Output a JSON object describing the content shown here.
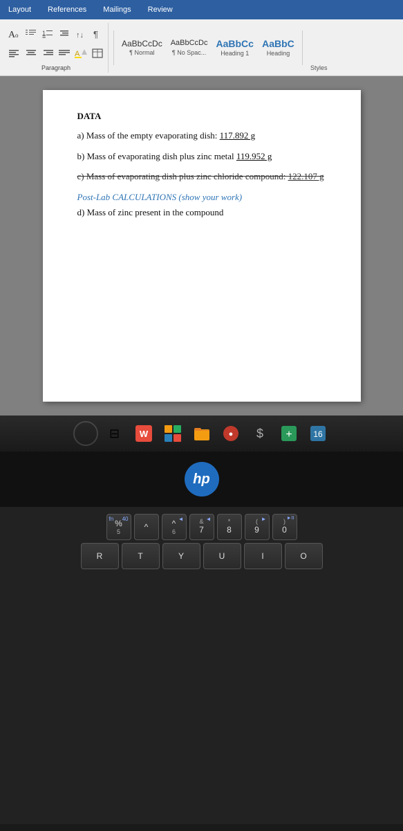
{
  "ribbon": {
    "tabs": [
      "Layout",
      "References",
      "Mailings",
      "Review"
    ],
    "paragraph_label": "Paragraph",
    "styles_label": "Styles",
    "styles": [
      {
        "preview": "AaBbCcDc",
        "label": "¶ Normal",
        "type": "normal"
      },
      {
        "preview": "AaBbCcDc",
        "label": "¶ No Spac...",
        "type": "nospace"
      },
      {
        "preview": "AaBbCc",
        "label": "Heading 1",
        "type": "heading1"
      },
      {
        "preview": "AaBbC",
        "label": "Heading",
        "type": "heading-cut"
      }
    ]
  },
  "document": {
    "data_title": "DATA",
    "items": [
      {
        "label": "a)  Mass of the empty evaporating dish:",
        "value": "117.892 g",
        "strikethrough": false
      },
      {
        "label": "b)  Mass of evaporating dish plus zinc metal",
        "value": "119.952 g",
        "strikethrough": false
      },
      {
        "label": "c)  Mass of evaporating dish plus zinc chloride compound:",
        "value": "122.107 g",
        "strikethrough": true
      },
      {
        "label": "Post-Lab  CALCULATIONS (show your work)",
        "value": "",
        "type": "heading"
      },
      {
        "label": "d)  Mass of zinc present in the compound",
        "value": "",
        "strikethrough": false
      }
    ]
  },
  "taskbar": {
    "items": [
      {
        "icon": "⊞",
        "name": "start-button"
      },
      {
        "icon": "⊟",
        "name": "task-view"
      },
      {
        "icon": "🔴",
        "name": "app1"
      },
      {
        "icon": "❖",
        "name": "app2"
      },
      {
        "icon": "📁",
        "name": "file-explorer"
      },
      {
        "icon": "🔴",
        "name": "app3"
      },
      {
        "icon": "💲",
        "name": "app4"
      },
      {
        "icon": "➕",
        "name": "app5"
      },
      {
        "icon": "🔔",
        "name": "app6"
      }
    ]
  },
  "hp_logo": "hp",
  "keyboard": {
    "rows": [
      {
        "keys": [
          {
            "top": "fn",
            "main": "5",
            "fn_label": "fn",
            "media": "40"
          },
          {
            "top": "",
            "main": "^",
            "fn_label": ""
          },
          {
            "top": "",
            "main": "6",
            "fn_label": "",
            "media": "◄"
          },
          {
            "top": "&",
            "main": "7",
            "fn_label": "",
            "media": "◄"
          },
          {
            "top": "*",
            "main": "8",
            "fn_label": ""
          },
          {
            "top": "(",
            "main": "9",
            "fn_label": "",
            "media": "►"
          },
          {
            "top": ")",
            "main": "0",
            "fn_label": "",
            "media": "►II"
          }
        ]
      },
      {
        "keys": [
          {
            "main": "R"
          },
          {
            "main": "T"
          },
          {
            "main": "Y"
          },
          {
            "main": "U"
          },
          {
            "main": "I"
          },
          {
            "main": "O"
          }
        ]
      }
    ]
  }
}
